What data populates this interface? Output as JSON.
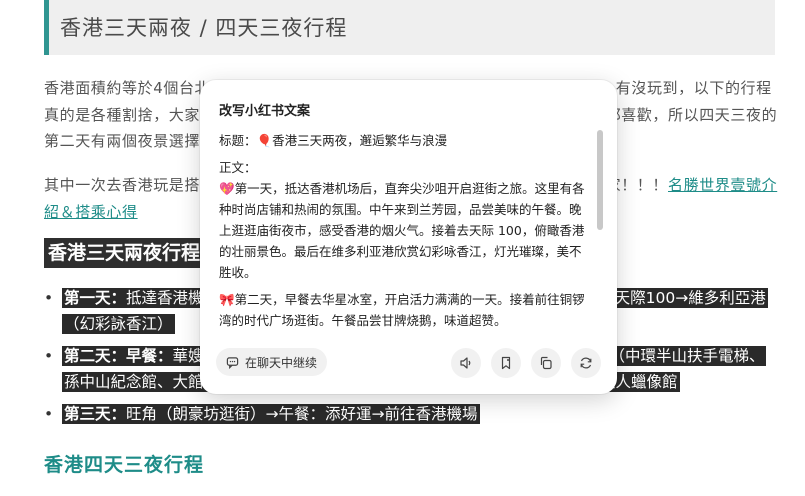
{
  "article": {
    "title": "香港三天兩夜 / 四天三夜行程",
    "para1": "香港面積約等於4個台北市，景點雖然多但其實只要安排得當，三天兩夜也能玩遍，有沒玩到，以下的行程真的是各種割捨，大家可以依自己喜好調整。我覺得香港的夜景真的很美，很多人都喜歡，所以四天三夜的第二天有兩個夜景選擇。",
    "para2_text": "其中一次去香港玩是搭乘名勝世界壹號遊輪前往，玩得非常開心，也強烈推薦給大家！！！",
    "para2_link": "名勝世界壹號介紹＆搭乘心得",
    "section_heading": "香港三天兩夜行程",
    "items": [
      {
        "label": "第一天：",
        "text": "抵達香港機場→尖沙咀→午餐：海港城、1881 Heritage→油麻地廟街→天際100→維多利亞港（幻彩詠香江）"
      },
      {
        "label": "第二天：早餐：",
        "text": "華嫂冰室→太子→旺角→銅鑼灣時代廣場→午餐：甘牌燒鵝→中環（中環半山扶手電梯、孫中山紀念館、大館）→太平山頂（凌霄閣摩天台428，香港超美夜景）→杜莎夫人蠟像館"
      },
      {
        "label": "第三天：",
        "text": "旺角（朗豪坊逛街）→午餐：添好運→前往香港機場"
      }
    ],
    "bottom_heading": "香港四天三夜行程"
  },
  "popup": {
    "title": "改写小红书文案",
    "heading_line": "标题：🎈香港三天两夜，邂逅繁华与浪漫",
    "body_label": "正文：",
    "para1": "💖第一天，抵达香港机场后，直奔尖沙咀开启逛街之旅。这里有各种时尚店铺和热闹的氛围。中午来到兰芳园，品尝美味的午餐。晚上逛逛庙街夜市，感受香港的烟火气。接着去天际 100，俯瞰香港的壮丽景色。最后在维多利亚港欣赏幻彩咏香江，灯光璀璨，美不胜收。",
    "para2": "🎀第二天，早餐去华星冰室，开启活力满满的一天。接着前往铜锣湾的时代广场逛街。午餐品尝甘牌烧鹅，味道超赞。",
    "continue_label": "在聊天中继续",
    "icons": [
      "chat-icon",
      "speaker-icon",
      "bookmark-icon",
      "copy-icon",
      "refresh-icon"
    ]
  }
}
